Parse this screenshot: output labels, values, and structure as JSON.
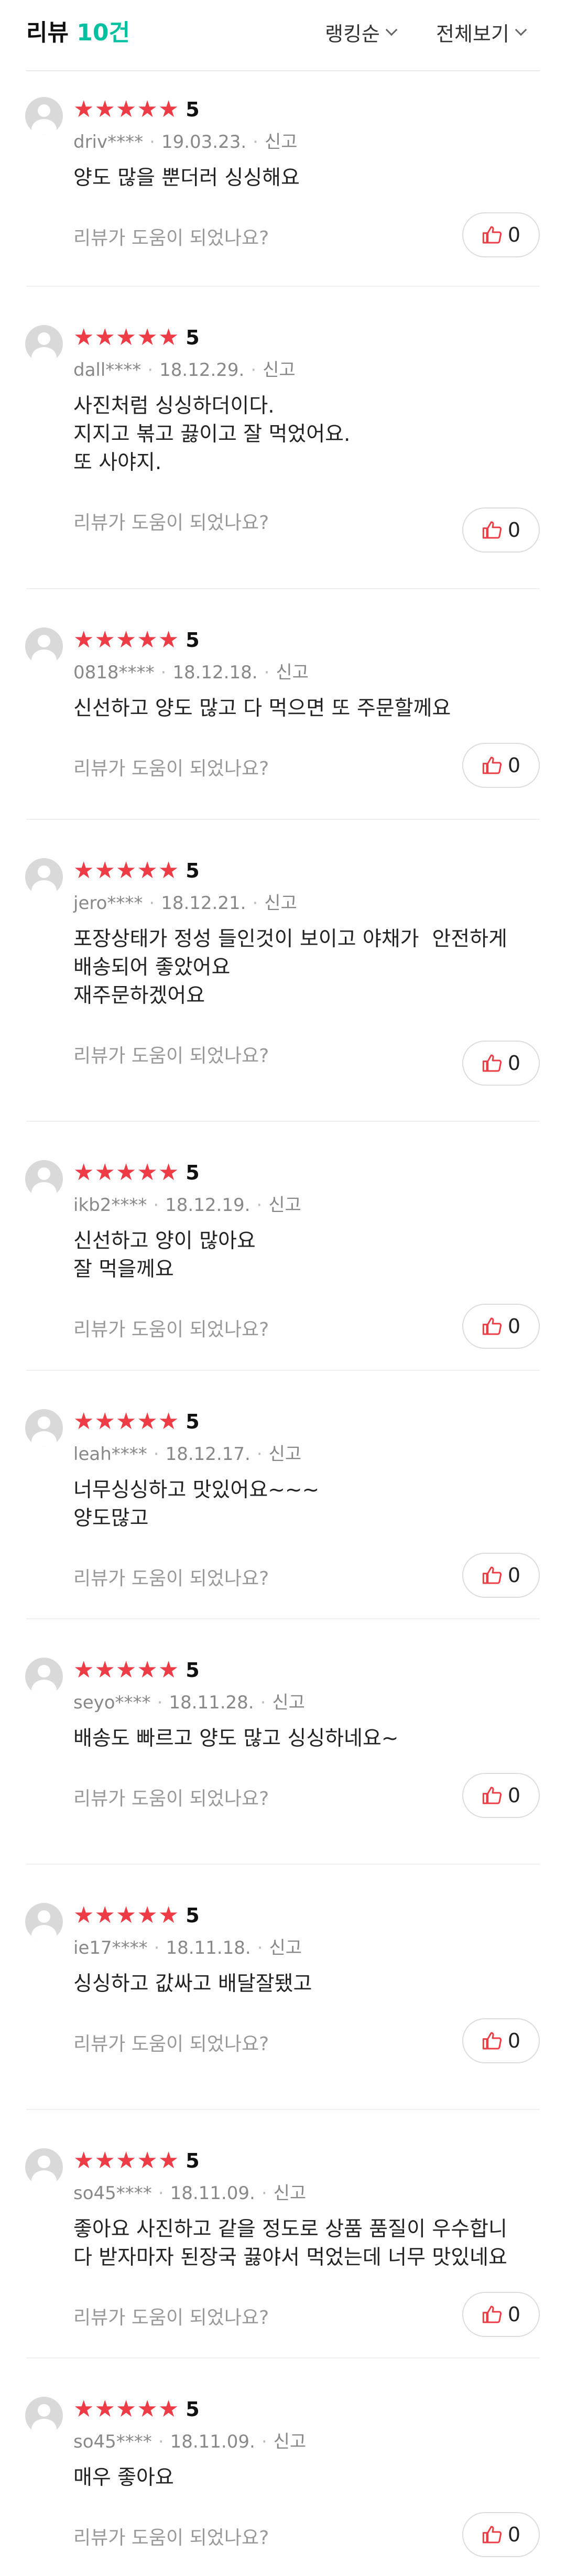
{
  "header": {
    "title_prefix": "리뷰 ",
    "title_count": "10건",
    "sort_label": "랭킹순",
    "filter_label": "전체보기"
  },
  "colors": {
    "accent": "#00c0a0",
    "star": "#ee3c46",
    "like_icon": "#ee3c46"
  },
  "review_common": {
    "helpful_text": "리뷰가 도움이 되었나요?",
    "report_label": "신고",
    "star_icon": "star-icon",
    "like_icon": "thumbs-up-icon"
  },
  "reviews": [
    {
      "rating": "5",
      "user": "driv****",
      "date": "19.03.23.",
      "lines": [
        "양도 많을 뿐더러 싱싱해요"
      ],
      "likes": "0"
    },
    {
      "rating": "5",
      "user": "dall****",
      "date": "18.12.29.",
      "lines": [
        "사진처럼 싱싱하더이다.",
        "지지고 볶고 끓이고 잘 먹었어요.",
        "또 사야지."
      ],
      "likes": "0"
    },
    {
      "rating": "5",
      "user": "0818****",
      "date": "18.12.18.",
      "lines": [
        "신선하고 양도 많고 다 먹으면 또 주문할께요"
      ],
      "likes": "0"
    },
    {
      "rating": "5",
      "user": "jero****",
      "date": "18.12.21.",
      "lines": [
        "포장상태가 정성 들인것이 보이고 야채가  안전하게",
        "배송되어 좋았어요",
        "재주문하겠어요"
      ],
      "likes": "0"
    },
    {
      "rating": "5",
      "user": "ikb2****",
      "date": "18.12.19.",
      "lines": [
        "신선하고 양이 많아요",
        "잘 먹을께요"
      ],
      "likes": "0"
    },
    {
      "rating": "5",
      "user": "leah****",
      "date": "18.12.17.",
      "lines": [
        "너무싱싱하고 맛있어요~~~",
        "양도많고"
      ],
      "likes": "0"
    },
    {
      "rating": "5",
      "user": "seyo****",
      "date": "18.11.28.",
      "lines": [
        "배송도 빠르고 양도 많고 싱싱하네요~"
      ],
      "likes": "0"
    },
    {
      "rating": "5",
      "user": "ie17****",
      "date": "18.11.18.",
      "lines": [
        "싱싱하고 값싸고 배달잘됐고"
      ],
      "likes": "0"
    },
    {
      "rating": "5",
      "user": "so45****",
      "date": "18.11.09.",
      "lines": [
        "좋아요 사진하고 같을 정도로 상품 품질이 우수합니",
        "다 받자마자 된장국 끓야서 먹었는데 너무 맛있네요"
      ],
      "likes": "0"
    },
    {
      "rating": "5",
      "user": "so45****",
      "date": "18.11.09.",
      "lines": [
        "매우 좋아요"
      ],
      "likes": "0"
    }
  ]
}
